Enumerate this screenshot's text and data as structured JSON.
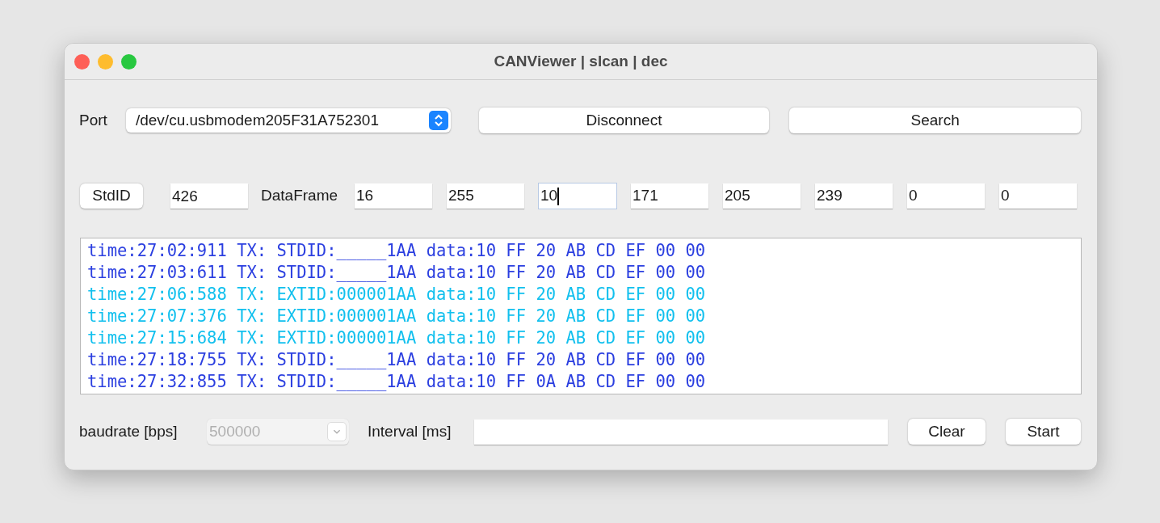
{
  "window": {
    "title": "CANViewer | slcan | dec"
  },
  "port": {
    "label": "Port",
    "value": "/dev/cu.usbmodem205F31A752301"
  },
  "buttons": [
    "Disconnect",
    "Search"
  ],
  "frame": {
    "id_button": "StdID",
    "id_value": "426",
    "data_label": "DataFrame",
    "data": [
      {
        "value": "16",
        "focused": false
      },
      {
        "value": "255",
        "focused": false
      },
      {
        "value": "10",
        "focused": true
      },
      {
        "value": "171",
        "focused": false
      },
      {
        "value": "205",
        "focused": false
      },
      {
        "value": "239",
        "focused": false
      },
      {
        "value": "0",
        "focused": false
      },
      {
        "value": "0",
        "focused": false
      }
    ]
  },
  "log": [
    {
      "text": "time:27:02:911 TX: STDID:_____1AA data:10 FF 20 AB CD EF 00 00",
      "color": "#2b3fe0"
    },
    {
      "text": "time:27:03:611 TX: STDID:_____1AA data:10 FF 20 AB CD EF 00 00",
      "color": "#2b3fe0"
    },
    {
      "text": "time:27:06:588 TX: EXTID:000001AA data:10 FF 20 AB CD EF 00 00",
      "color": "#12c0ee"
    },
    {
      "text": "time:27:07:376 TX: EXTID:000001AA data:10 FF 20 AB CD EF 00 00",
      "color": "#12c0ee"
    },
    {
      "text": "time:27:15:684 TX: EXTID:000001AA data:10 FF 20 AB CD EF 00 00",
      "color": "#12c0ee"
    },
    {
      "text": "time:27:18:755 TX: STDID:_____1AA data:10 FF 20 AB CD EF 00 00",
      "color": "#2b3fe0"
    },
    {
      "text": "time:27:32:855 TX: STDID:_____1AA data:10 FF 0A AB CD EF 00 00",
      "color": "#2b3fe0"
    }
  ],
  "bottom": {
    "baud_label": "baudrate [bps]",
    "baud_value": "500000",
    "baud_disabled": true,
    "interval_label": "Interval [ms]",
    "actions": [
      "Clear",
      "Start"
    ]
  }
}
